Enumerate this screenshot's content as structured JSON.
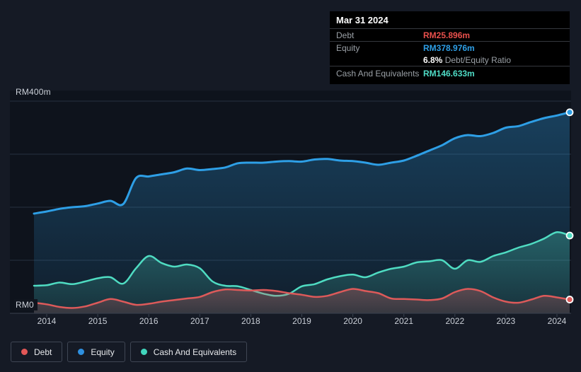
{
  "tooltip": {
    "date": "Mar 31 2024",
    "debt_label": "Debt",
    "debt_value": "RM25.896m",
    "debt_color": "#e8504c",
    "equity_label": "Equity",
    "equity_value": "RM378.976m",
    "equity_color": "#2e9fe6",
    "ratio_value": "6.8%",
    "ratio_label": "Debt/Equity Ratio",
    "cash_label": "Cash And Equivalents",
    "cash_value": "RM146.633m",
    "cash_color": "#4fdcc6"
  },
  "y_axis": {
    "top_label": "RM400m",
    "zero_label": "RM0"
  },
  "x_axis": {
    "years": [
      "2014",
      "2015",
      "2016",
      "2017",
      "2018",
      "2019",
      "2020",
      "2021",
      "2022",
      "2023",
      "2024"
    ]
  },
  "legend": {
    "items": [
      {
        "label": "Debt",
        "color": "#e25757"
      },
      {
        "label": "Equity",
        "color": "#2e90e0"
      },
      {
        "label": "Cash And Equivalents",
        "color": "#41d6bd"
      }
    ]
  },
  "chart_data": {
    "type": "area",
    "title": "Debt to Equity history",
    "unit": "RM millions",
    "x_start": 2013.75,
    "x_step": 0.25,
    "x_tick_years": [
      2014,
      2015,
      2016,
      2017,
      2018,
      2019,
      2020,
      2021,
      2022,
      2023,
      2024
    ],
    "ylim": [
      0,
      400
    ],
    "gridline_values": [
      100,
      200,
      300,
      400
    ],
    "legend_position": "bottom-left",
    "series": [
      {
        "id": "equity",
        "name": "Equity",
        "color": "#2e9fe6",
        "values": [
          188,
          192,
          197,
          200,
          202,
          207,
          212,
          206,
          255,
          258,
          262,
          266,
          273,
          270,
          272,
          275,
          283,
          284,
          284,
          286,
          287,
          286,
          290,
          291,
          288,
          287,
          284,
          280,
          284,
          288,
          297,
          307,
          317,
          330,
          336,
          334,
          340,
          350,
          353,
          361,
          368,
          373,
          378.976
        ]
      },
      {
        "id": "cash",
        "name": "Cash And Equivalents",
        "color": "#4fdcc2",
        "values": [
          52,
          53,
          58,
          55,
          60,
          66,
          68,
          56,
          85,
          108,
          95,
          88,
          92,
          85,
          60,
          52,
          51,
          44,
          37,
          33,
          37,
          51,
          55,
          64,
          70,
          73,
          68,
          77,
          84,
          88,
          96,
          98,
          100,
          84,
          100,
          97,
          108,
          115,
          124,
          131,
          141,
          153,
          146.633
        ]
      },
      {
        "id": "debt",
        "name": "Debt",
        "color": "#dd5a5a",
        "values": [
          20,
          17,
          12,
          10,
          13,
          20,
          27,
          22,
          16,
          18,
          22,
          25,
          28,
          31,
          40,
          45,
          44,
          43,
          44,
          42,
          38,
          35,
          31,
          33,
          40,
          46,
          42,
          38,
          28,
          27,
          26,
          25,
          28,
          40,
          46,
          42,
          30,
          22,
          20,
          26,
          33,
          30,
          25.896
        ]
      }
    ]
  }
}
